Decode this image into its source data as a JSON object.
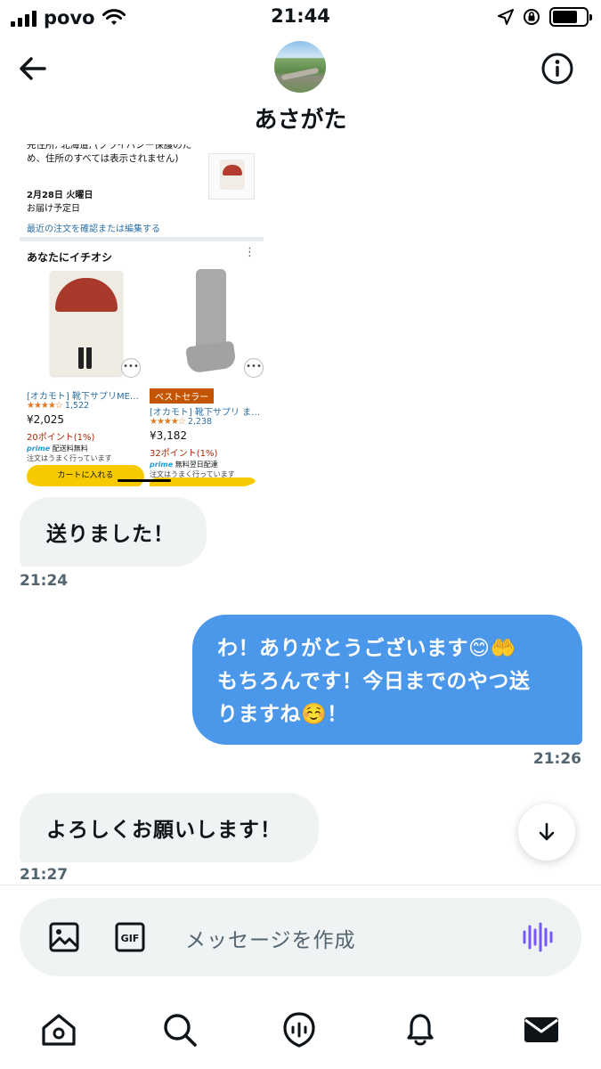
{
  "status_bar": {
    "carrier": "povo",
    "time": "21:44"
  },
  "header": {
    "contact_name": "あさがた"
  },
  "shared_image": {
    "address_lines": [
      "先住所, 北海道, (プライバシー保護のた",
      "め、住所のすべては表示されません)"
    ],
    "address_label": "先住所",
    "delivery_date": "2月28日 火曜日",
    "delivery_note": "お届け予定日",
    "edit_link": "最近の注文を確認または編集する",
    "recommend_title": "あなたにイチオシ",
    "products": [
      {
        "title": "[オカモト] 靴下サプリME…",
        "stars": "★★★★☆",
        "reviews": "1,522",
        "price": "¥2,025",
        "points": "20ポイント(1%)",
        "prime_label": "prime",
        "shipping": "配送料無料",
        "stock": "注文はうまく行っています"
      },
      {
        "badge": "ベストセラー",
        "title": "[オカモト] 靴下サプリ ま…",
        "stars": "★★★★☆",
        "reviews": "2,238",
        "price": "¥3,182",
        "points": "32ポイント(1%)",
        "prime_label": "prime",
        "shipping": "無料翌日配達",
        "stock": "注文はうまく行っています"
      }
    ],
    "cart_button": "カートに入れる"
  },
  "messages": [
    {
      "direction": "in",
      "text": "送りました！",
      "time": "21:24"
    },
    {
      "direction": "out",
      "lines": [
        "わ！ありがとうございます😊🤲",
        "もちろんです！今日までのやつ送",
        "りますね☺️！"
      ],
      "time": "21:26"
    },
    {
      "direction": "in",
      "text": "よろしくお願いします！",
      "time": "21:27"
    }
  ],
  "composer": {
    "placeholder": "メッセージを作成",
    "gif_label": "GIF"
  },
  "colors": {
    "outgoing_bubble": "#4b97e9",
    "incoming_bubble": "#eff3f4",
    "voice_accent": "#7856ff"
  }
}
